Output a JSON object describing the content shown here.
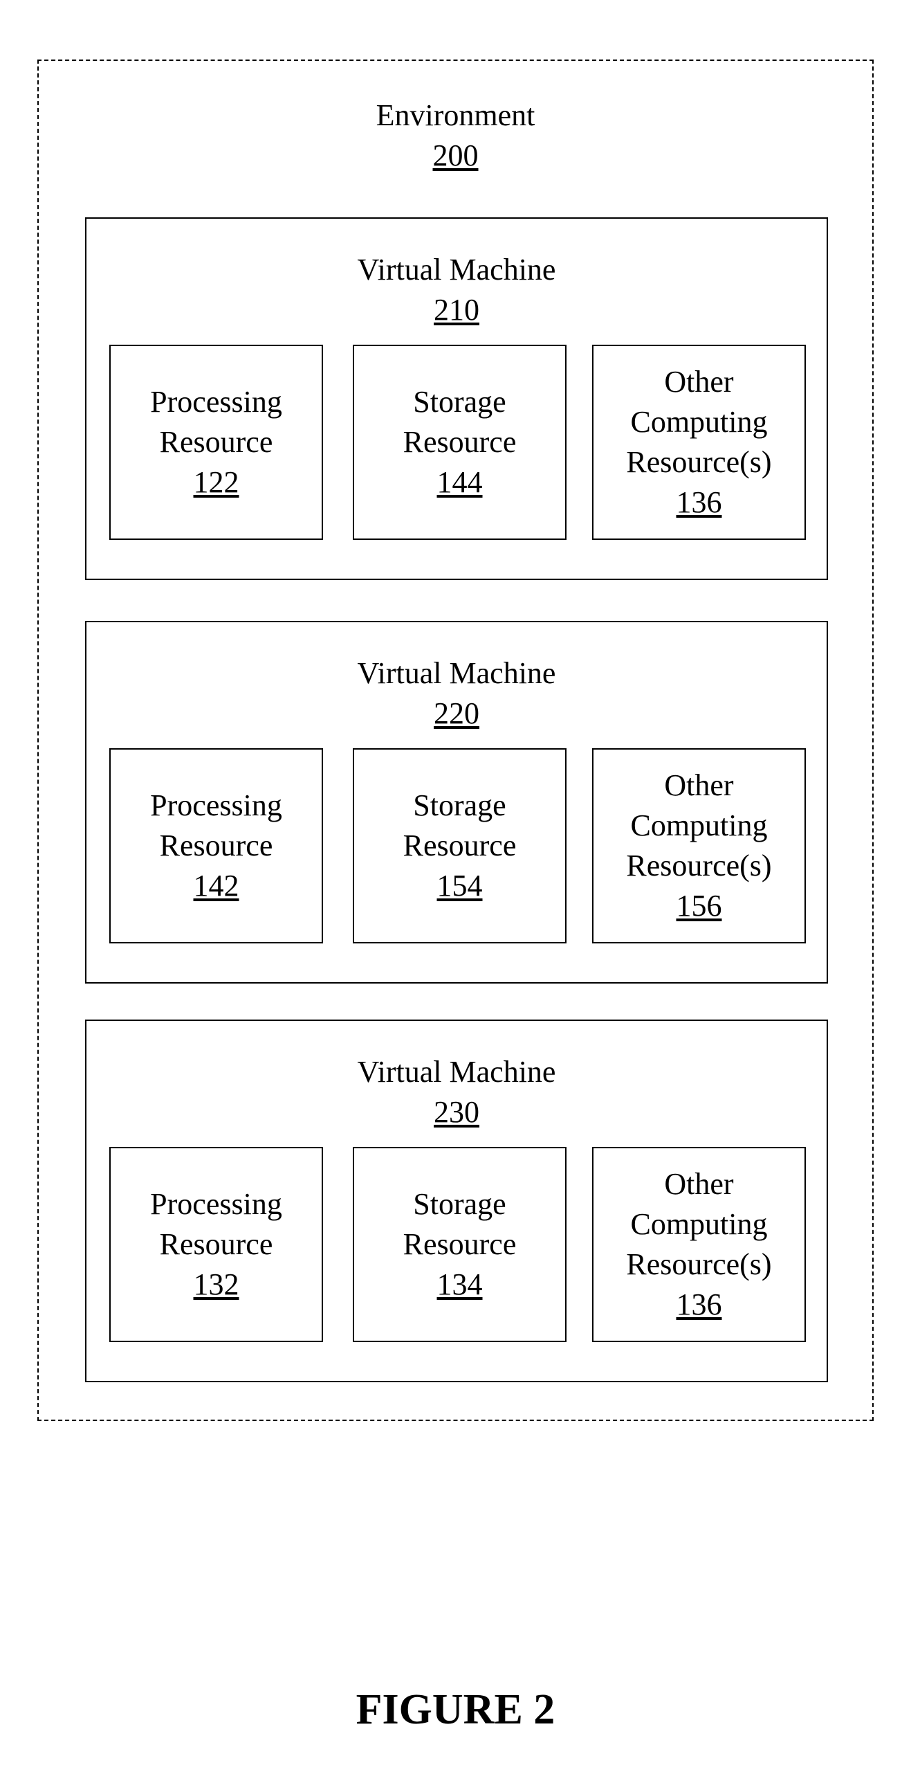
{
  "environment": {
    "title": "Environment",
    "number": "200"
  },
  "virtual_machines": [
    {
      "title": "Virtual Machine",
      "number": "210",
      "resources": [
        {
          "lines": [
            "Processing",
            "Resource"
          ],
          "number": "122"
        },
        {
          "lines": [
            "Storage",
            "Resource"
          ],
          "number": "144"
        },
        {
          "lines": [
            "Other",
            "Computing",
            "Resource(s)"
          ],
          "number": "136"
        }
      ]
    },
    {
      "title": "Virtual Machine",
      "number": "220",
      "resources": [
        {
          "lines": [
            "Processing",
            "Resource"
          ],
          "number": "142"
        },
        {
          "lines": [
            "Storage",
            "Resource"
          ],
          "number": "154"
        },
        {
          "lines": [
            "Other",
            "Computing",
            "Resource(s)"
          ],
          "number": "156"
        }
      ]
    },
    {
      "title": "Virtual Machine",
      "number": "230",
      "resources": [
        {
          "lines": [
            "Processing",
            "Resource"
          ],
          "number": "132"
        },
        {
          "lines": [
            "Storage",
            "Resource"
          ],
          "number": "134"
        },
        {
          "lines": [
            "Other",
            "Computing",
            "Resource(s)"
          ],
          "number": "136"
        }
      ]
    }
  ],
  "figure_label": "FIGURE 2"
}
